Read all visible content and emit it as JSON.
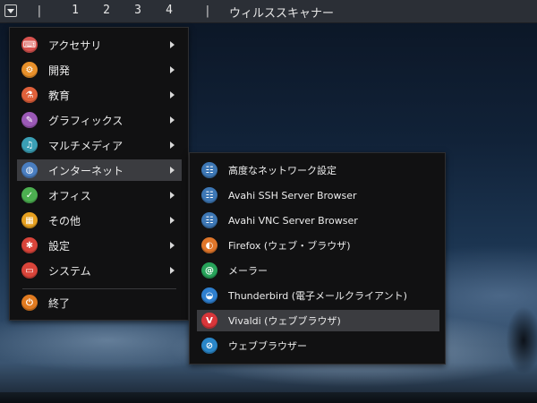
{
  "taskbar": {
    "separator": "|",
    "workspaces": [
      "1",
      "2",
      "3",
      "4"
    ],
    "active_window_title": "ウィルススキャナー"
  },
  "main_menu": {
    "items": [
      {
        "label": "アクセサリ",
        "icon": "accessories-icon",
        "color": "#d9534f",
        "glyph": "⌨"
      },
      {
        "label": "開発",
        "icon": "development-icon",
        "color": "#e8902a",
        "glyph": "⚙"
      },
      {
        "label": "教育",
        "icon": "education-icon",
        "color": "#e0603a",
        "glyph": "⚗"
      },
      {
        "label": "グラフィックス",
        "icon": "graphics-icon",
        "color": "#9b59b6",
        "glyph": "✎"
      },
      {
        "label": "マルチメディア",
        "icon": "multimedia-icon",
        "color": "#3a9fb5",
        "glyph": "♫"
      },
      {
        "label": "インターネット",
        "icon": "internet-icon",
        "color": "#4a7ec0",
        "glyph": "◍"
      },
      {
        "label": "オフィス",
        "icon": "office-icon",
        "color": "#4caf50",
        "glyph": "✓"
      },
      {
        "label": "その他",
        "icon": "other-icon",
        "color": "#e6a020",
        "glyph": "▦"
      },
      {
        "label": "設定",
        "icon": "settings-icon",
        "color": "#d9443a",
        "glyph": "✱"
      },
      {
        "label": "システム",
        "icon": "system-icon",
        "color": "#d9443a",
        "glyph": "▭"
      }
    ],
    "quit": {
      "label": "終了",
      "icon": "quit-icon",
      "color": "#e07a20",
      "glyph": "⏻"
    }
  },
  "sub_menu": {
    "items": [
      {
        "label": "高度なネットワーク設定",
        "icon": "network-settings-icon",
        "color": "#3d77b5",
        "glyph": "☷"
      },
      {
        "label": "Avahi SSH Server Browser",
        "icon": "avahi-ssh-icon",
        "color": "#3d77b5",
        "glyph": "☷"
      },
      {
        "label": "Avahi VNC Server Browser",
        "icon": "avahi-vnc-icon",
        "color": "#3d77b5",
        "glyph": "☷"
      },
      {
        "label": "Firefox (ウェブ・ブラウザ)",
        "icon": "firefox-icon",
        "color": "#e0762a",
        "glyph": "◐"
      },
      {
        "label": "メーラー",
        "icon": "mailer-icon",
        "color": "#27a35a",
        "glyph": "@"
      },
      {
        "label": "Thunderbird (電子メールクライアント)",
        "icon": "thunderbird-icon",
        "color": "#2e7fcf",
        "glyph": "◒"
      },
      {
        "label": "Vivaldi (ウェブブラウザ)",
        "icon": "vivaldi-icon",
        "color": "#d8363a",
        "glyph": "V"
      },
      {
        "label": "ウェブブラウザー",
        "icon": "web-browser-icon",
        "color": "#2a86c8",
        "glyph": "⊘"
      }
    ]
  }
}
